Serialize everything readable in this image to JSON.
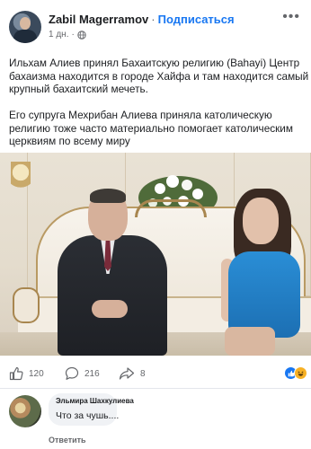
{
  "post": {
    "author": "Zabil Magerramov",
    "separator": "·",
    "follow_label": "Подписаться",
    "time": "1 дн.",
    "time_separator": "·",
    "more_label": "•••",
    "paragraphs": [
      "Ильхам Алиев принял Бахаитскую религию (Bahayi) Центр бахаизма находится в городе Хайфа и там находится самый крупный бахаитский мечеть.",
      "Его супруга Мехрибан Алиева приняла католическую религию тоже часто материально помогает католическим церквиям по всему миру"
    ]
  },
  "stats": {
    "likes": "120",
    "comments": "216",
    "shares": "8"
  },
  "comment": {
    "author": "Эльмира Шахкулиева",
    "text": "Что за чушь....",
    "reply_label": "Ответить"
  },
  "colors": {
    "accent": "#1877f2",
    "like_reaction": "#1877f2",
    "haha_reaction": "#f7b125"
  },
  "icons": {
    "privacy": "globe-icon",
    "like": "thumbs-up-icon",
    "comment": "comment-bubble-icon",
    "share": "share-arrow-icon"
  }
}
